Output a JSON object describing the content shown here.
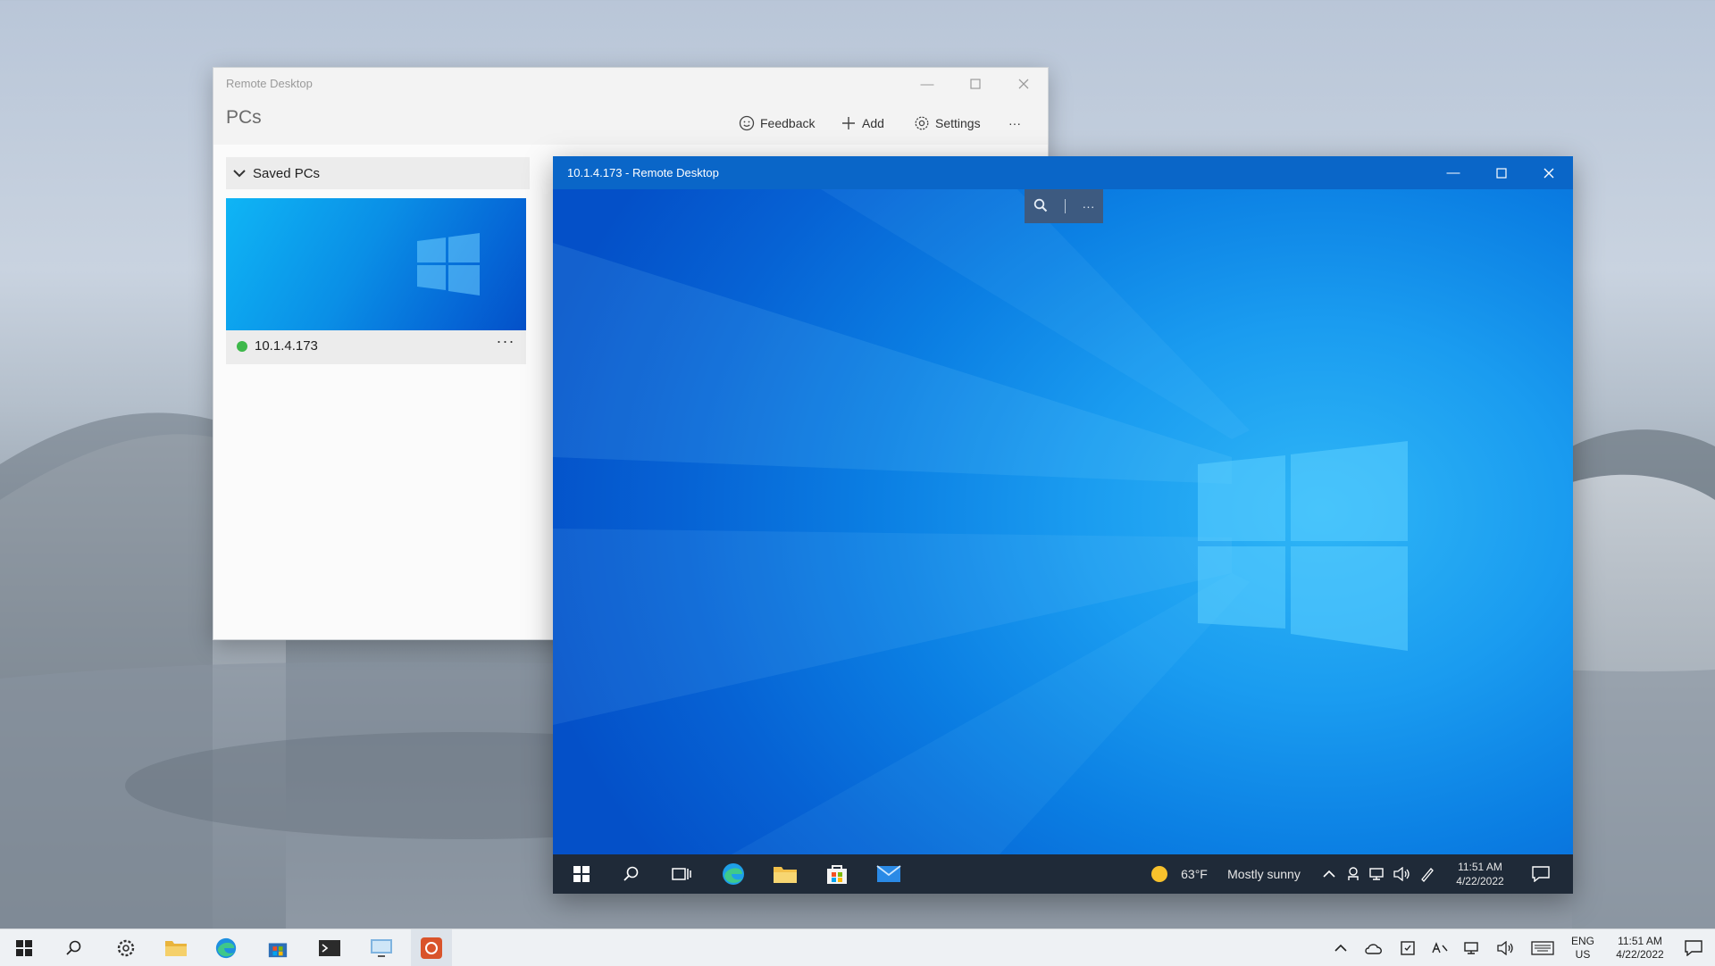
{
  "host_window": {
    "title": "Remote Desktop",
    "header_title": "PCs",
    "actions": {
      "feedback_label": "Feedback",
      "add_label": "Add",
      "settings_label": "Settings",
      "more_label": "···"
    },
    "group_label": "Saved PCs",
    "pc_card": {
      "name": "10.1.4.173",
      "status_color": "#3db84a",
      "more_label": "···"
    }
  },
  "session_window": {
    "title": "10.1.4.173 - Remote Desktop",
    "zoom_bar": {
      "zoom_icon": "magnifier-icon",
      "more_label": "···"
    },
    "taskbar": {
      "weather_temp": "63°F",
      "weather_text": "Mostly sunny",
      "time": "11:51 AM",
      "date": "4/22/2022"
    }
  },
  "host_taskbar": {
    "language": "ENG",
    "region": "US",
    "time": "11:51 AM",
    "date": "4/22/2022"
  },
  "colors": {
    "session_titlebar": "#0a66c8",
    "session_taskbar": "#1f2a38",
    "accent_blue": "#0a8fe6"
  }
}
